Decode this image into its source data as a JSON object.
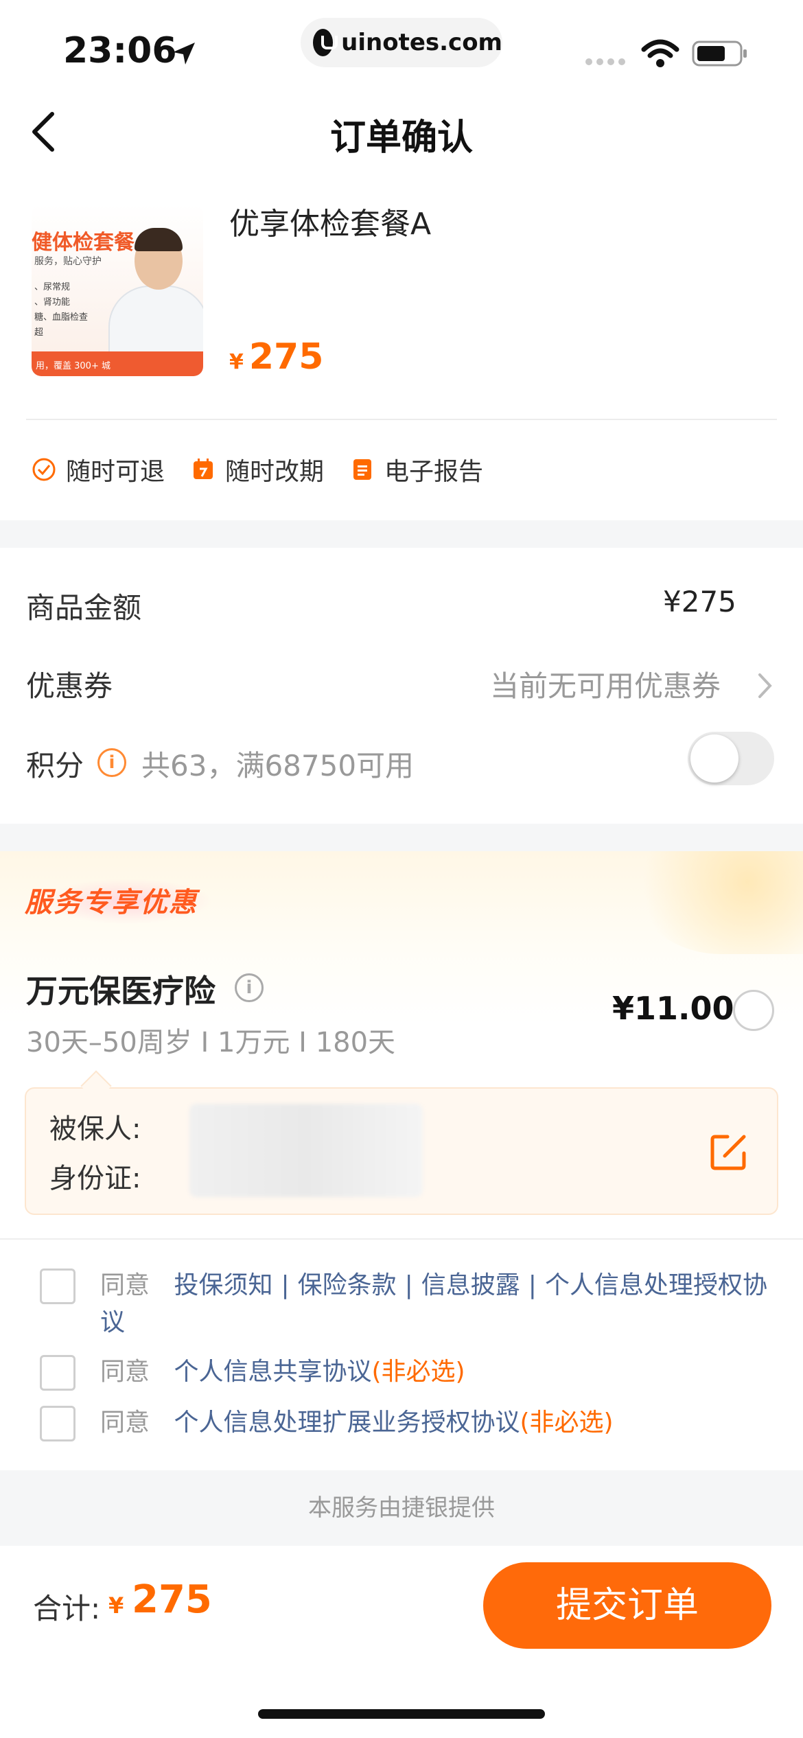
{
  "status_bar": {
    "time": "23:06",
    "url": "uinotes.com"
  },
  "nav": {
    "title": "订单确认"
  },
  "product": {
    "image_banner": "健体检套餐A",
    "image_sub": "服务，贴心守护",
    "image_lines": [
      "、尿常规",
      "、肾功能",
      "糖、血脂检查",
      "超"
    ],
    "image_bottom": "用，覆盖 300+ 城",
    "name": "优享体检套餐A",
    "price_symbol": "¥",
    "price": "275"
  },
  "features": [
    {
      "label": "随时可退",
      "icon": "check-circle-icon"
    },
    {
      "label": "随时改期",
      "icon": "calendar-icon"
    },
    {
      "label": "电子报告",
      "icon": "document-icon"
    }
  ],
  "amounts": {
    "goods_label": "商品金额",
    "goods_value": "¥275",
    "coupon_label": "优惠券",
    "coupon_value": "当前无可用优惠券",
    "points_label": "积分",
    "points_desc": "共63，满68750可用",
    "points_enabled": false
  },
  "service": {
    "tag": "服务专享优惠",
    "insurance_title": "万元保医疗险",
    "insurance_desc": "30天–50周岁 I 1万元 I 180天",
    "insurance_price": "¥11.00",
    "insured_label": "被保人:",
    "id_label": "身份证:"
  },
  "agreements": {
    "agree_word": "同意",
    "row1_links": [
      "投保须知",
      "保险条款",
      "信息披露",
      "个人信息处理授权协议"
    ],
    "row1_sep": "|",
    "row2_link": "个人信息共享协议",
    "row2_optional": "(非必选)",
    "row3_link": "个人信息处理扩展业务授权协议",
    "row3_optional": "(非必选)"
  },
  "provider": "本服务由捷银提供",
  "footer": {
    "total_label": "合计:",
    "total_symbol": "¥",
    "total_value": "275",
    "submit_label": "提交订单"
  },
  "colors": {
    "accent": "#ff6a00",
    "link": "#4a6594",
    "muted": "#999999"
  }
}
